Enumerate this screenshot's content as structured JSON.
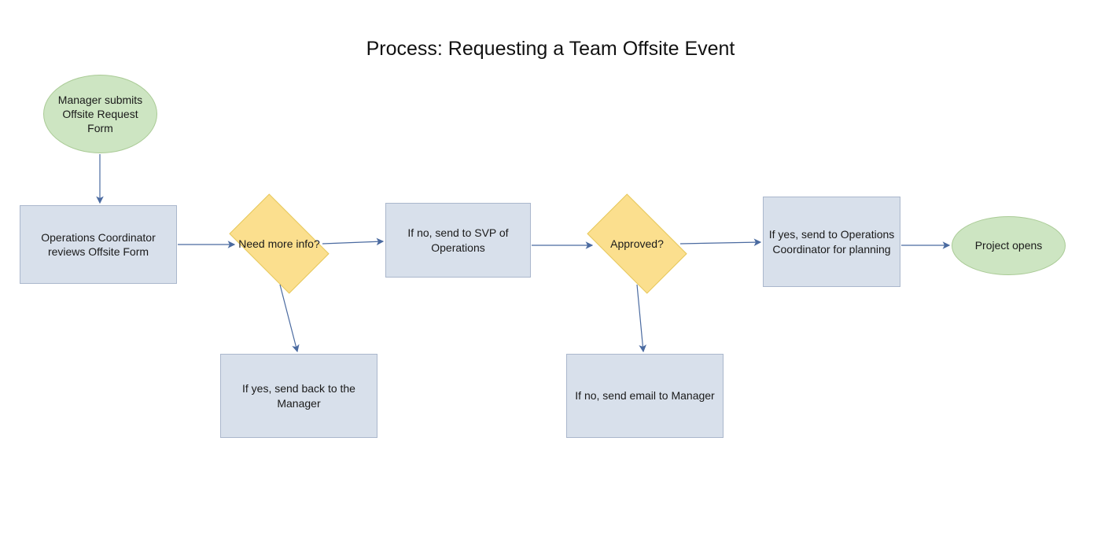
{
  "title": "Process: Requesting a Team Offsite Event",
  "colors": {
    "process_fill": "#d8e0eb",
    "process_stroke": "#aab7cc",
    "terminator_fill": "#cde5c2",
    "terminator_stroke": "#aacb96",
    "decision_fill": "#fbdf8e",
    "decision_stroke": "#e6c75a",
    "arrow": "#4a6aa0"
  },
  "nodes": {
    "start": {
      "type": "terminator",
      "label": "Manager submits Offsite Request Form"
    },
    "review": {
      "type": "process",
      "label": "Operations Coordinator reviews Offsite Form"
    },
    "need_more_info": {
      "type": "decision",
      "label": "Need more info?"
    },
    "send_back_manager": {
      "type": "process",
      "label": "If yes, send back to the Manager"
    },
    "send_svp": {
      "type": "process",
      "label": "If no, send to SVP of Operations"
    },
    "approved": {
      "type": "decision",
      "label": "Approved?"
    },
    "email_manager": {
      "type": "process",
      "label": "If no, send email to Manager"
    },
    "coordinator_planning": {
      "type": "process",
      "label": "If yes, send to Operations Coordinator for planning"
    },
    "end": {
      "type": "terminator",
      "label": "Project opens"
    }
  },
  "edges": [
    {
      "from": "start",
      "to": "review"
    },
    {
      "from": "review",
      "to": "need_more_info"
    },
    {
      "from": "need_more_info",
      "to": "send_svp",
      "branch": "no"
    },
    {
      "from": "need_more_info",
      "to": "send_back_manager",
      "branch": "yes"
    },
    {
      "from": "send_svp",
      "to": "approved"
    },
    {
      "from": "approved",
      "to": "coordinator_planning",
      "branch": "yes"
    },
    {
      "from": "approved",
      "to": "email_manager",
      "branch": "no"
    },
    {
      "from": "coordinator_planning",
      "to": "end"
    }
  ]
}
